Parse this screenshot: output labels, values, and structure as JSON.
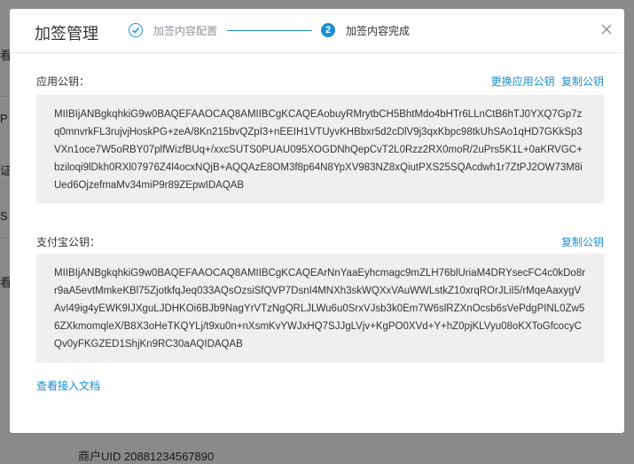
{
  "background": {
    "glyphs": [
      "看",
      "P",
      "证",
      "S",
      "看"
    ],
    "footer_text": "商户UID  20881234567890"
  },
  "modal": {
    "title": "加签管理",
    "steps": [
      {
        "number": "1",
        "label": "加签内容配置",
        "status": "done",
        "icon": "check-icon"
      },
      {
        "number": "2",
        "label": "加签内容完成",
        "status": "active"
      }
    ],
    "close_icon": "close-icon"
  },
  "app_public_key": {
    "label": "应用公钥：",
    "actions": [
      "更换应用公钥",
      "复制公钥"
    ],
    "value": "MIIBIjANBgkqhkiG9w0BAQEFAAOCAQ8AMIIBCgKCAQEAobuyRMrytbCH5BhtMdo4bHTr6LLnCtB6hTJ0YXQ7Gp7zq0mnvrkFL3rujvjHoskPG+zeA/8Kn215bvQZpI3+nEEIH1VTUyvKHBbxr5d2cDlV9j3qxKbpc98tkUhSAo1qHD7GKkSp3VXn1oce7W5oRBY07plfWizfBUq+/xxcSUTS0PUAU095XOGDNhQepCvT2L0Rzz2RX0moR/2uPrs5K1L+0aKRVGC+bziloqi9lDkh0RXl07976Z4l4ocxNQjB+AQQAzE8OM3f8p64N8YpXV983NZ8xQiutPXS25SQAcdwh1r7ZtPJ2OW73M8iUed6OjzefmaMv34miP9r89ZEpwIDAQAB"
  },
  "alipay_public_key": {
    "label": "支付宝公钥：",
    "actions": [
      "复制公钥"
    ],
    "value": "MIIBIjANBgkqhkiG9w0BAQEFAAOCAQ8AMIIBCgKCAQEArNnYaaEyhcmagc9mZLH76blUriaM4DRYsecFC4c0kDo8rr9aA5evtMmkeKBl75ZjotkfqJeq033AQsOzsiSfQVP7DsnI4MNXh3skWQXxVAuWWLstkZ10xrqROrJLiI5/rMqeAaxygVAvI49ig4yEWK9IJXguLJDHKOi6BJb9NagYrVTzNgQRLJLWu6u0SrxVJsb3k0Em7W6slRZXnOcsb6sVePdgPINL0Zw56ZXkmomqleX/B8X3oHeTKQYLj/t9xu0n+nXsmKvYWJxHQ7SJJgLVjv+KgPO0XVd+Y+hZ0pjKLVyu08oKXToGfcocyCQv0yFKGZED1ShjKn9RC30aAQIDAQAB"
  },
  "doc_link": "查看接入文档"
}
